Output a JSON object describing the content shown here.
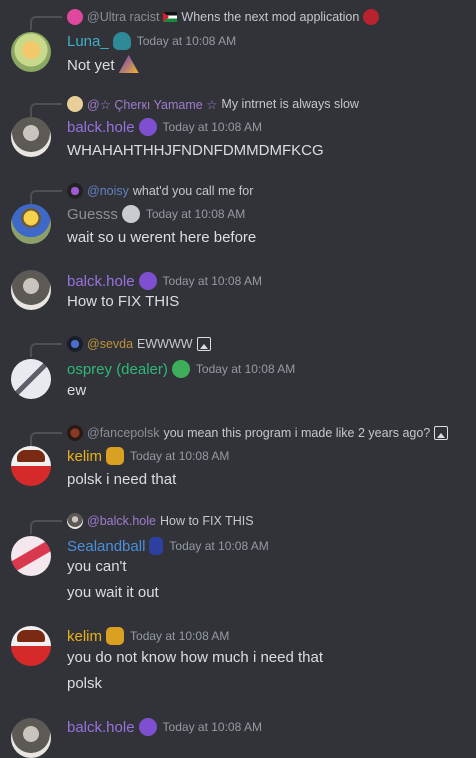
{
  "colors": {
    "background": "#313338",
    "timestamp": "#949ba4",
    "text": "#dbdee1",
    "luna": "#3fb0c8",
    "balck": "#9a72e0",
    "guesss": "#8c8f96",
    "osprey": "#2fb87a",
    "kelim": "#e8b21c",
    "sealandball": "#4b8fdc"
  },
  "messages": [
    {
      "reply": {
        "name": "@Ultra racist",
        "text": "Whens the next mod application"
      },
      "author": "Luna_",
      "timestamp": "Today at 10:08 AM",
      "lines": [
        "Not yet"
      ]
    },
    {
      "reply": {
        "name": "@☆ Çherкı Yamame ☆",
        "text": "My intrnet is always slow"
      },
      "author": "balck.hole",
      "timestamp": "Today at 10:08 AM",
      "lines": [
        "WHAHAHTHHJFNDNFDMMDMFKCG"
      ]
    },
    {
      "reply": {
        "name": "@noisy",
        "text": "what'd you call me for"
      },
      "author": "Guesss",
      "timestamp": "Today at 10:08 AM",
      "lines": [
        "wait so u werent here before"
      ]
    },
    {
      "reply": null,
      "author": "balck.hole",
      "timestamp": "Today at 10:08 AM",
      "lines": [
        "How to FIX THIS"
      ]
    },
    {
      "reply": {
        "name": "@sevda",
        "text": "EWWWW"
      },
      "author": "osprey (dealer)",
      "timestamp": "Today at 10:08 AM",
      "lines": [
        "ew"
      ]
    },
    {
      "reply": {
        "name": "@fancepolsk",
        "text": "you mean this program i made like 2 years ago?"
      },
      "author": "kelim",
      "timestamp": "Today at 10:08 AM",
      "lines": [
        "polsk i need that"
      ]
    },
    {
      "reply": {
        "name": "@balck.hole",
        "text": "How to FIX THIS"
      },
      "author": "Sealandball",
      "timestamp": "Today at 10:08 AM",
      "lines": [
        "you can't",
        "you wait it out"
      ]
    },
    {
      "reply": null,
      "author": "kelim",
      "timestamp": "Today at 10:08 AM",
      "lines": [
        "you do not know how much i need that",
        "polsk"
      ]
    },
    {
      "reply": null,
      "author": "balck.hole",
      "timestamp": "Today at 10:08 AM",
      "lines": []
    }
  ]
}
